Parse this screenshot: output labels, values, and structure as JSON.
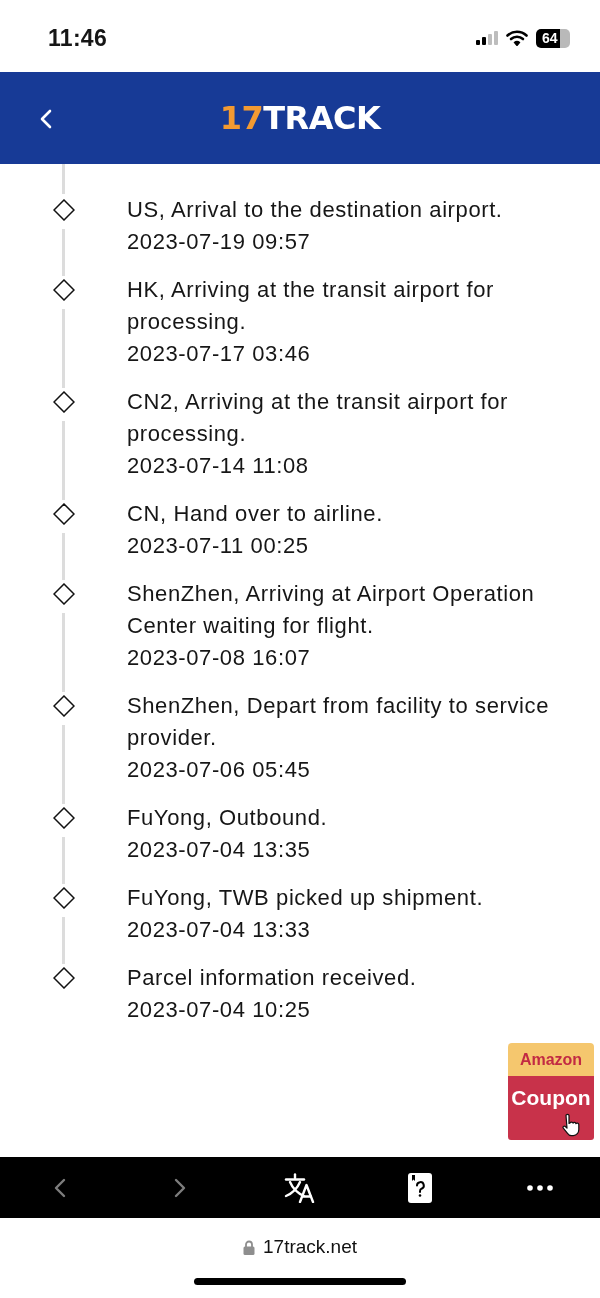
{
  "status_bar": {
    "time": "11:46",
    "battery": "64"
  },
  "header": {
    "logo": {
      "accent": "17",
      "rest": "TRACK"
    }
  },
  "events": [
    {
      "description": "US, Arrival to the destination airport.",
      "time": "2023-07-19 09:57"
    },
    {
      "description": "HK, Arriving at the transit airport for processing.",
      "time": "2023-07-17 03:46"
    },
    {
      "description": "CN2, Arriving at the transit airport for processing.",
      "time": "2023-07-14 11:08"
    },
    {
      "description": "CN, Hand over to airline.",
      "time": "2023-07-11 00:25"
    },
    {
      "description": "ShenZhen, Arriving at Airport Operation Center waiting for flight.",
      "time": "2023-07-08 16:07"
    },
    {
      "description": "ShenZhen, Depart from facility to service provider.",
      "time": "2023-07-06 05:45"
    },
    {
      "description": "FuYong, Outbound.",
      "time": "2023-07-04 13:35"
    },
    {
      "description": "FuYong, TWB picked up shipment.",
      "time": "2023-07-04 13:33"
    },
    {
      "description": "Parcel information received.",
      "time": "2023-07-04 10:25"
    }
  ],
  "coupon": {
    "brand": "Amazon",
    "label": "Coupon"
  },
  "browser_toolbar": {
    "buttons": [
      {
        "kind": "back",
        "disabled": true
      },
      {
        "kind": "forward",
        "disabled": true
      },
      {
        "kind": "translate",
        "disabled": false
      },
      {
        "kind": "help-card",
        "disabled": false
      },
      {
        "kind": "more",
        "disabled": false
      }
    ]
  },
  "address_bar": {
    "url": "17track.net"
  }
}
